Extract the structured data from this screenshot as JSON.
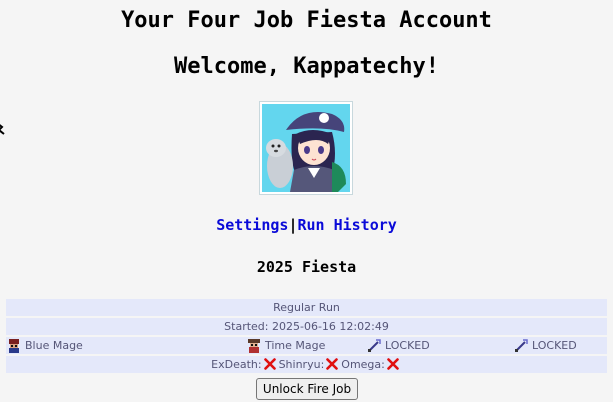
{
  "header": {
    "title": "Your Four Job Fiesta Account",
    "welcome": "Welcome, Kappatechy!"
  },
  "avatar": {
    "icon": "anime-girl-with-seal-avatar"
  },
  "nav": {
    "settings_label": "Settings",
    "separator": "|",
    "run_history_label": "Run History"
  },
  "fiesta": {
    "year_label": "2025 Fiesta"
  },
  "run": {
    "type_label": "Regular Run",
    "started_label": "Started: 2025-06-16 12:02:49",
    "jobs": [
      {
        "name": "Blue Mage",
        "icon": "blue-mage-sprite-icon"
      },
      {
        "name": "Time Mage",
        "icon": "time-mage-sprite-icon"
      },
      {
        "name": "LOCKED",
        "icon": "sword-icon"
      },
      {
        "name": "LOCKED",
        "icon": "sword-icon"
      }
    ],
    "bosses": [
      {
        "name": "ExDeath:",
        "status": "x-mark-icon"
      },
      {
        "name": "Shinryu:",
        "status": "x-mark-icon"
      },
      {
        "name": "Omega:",
        "status": "x-mark-icon"
      }
    ],
    "unlock_button_label": "Unlock Fire Job"
  },
  "colors": {
    "background": "#f5f5f5",
    "row_background": "#e4e8fa",
    "link": "#0a0ad8",
    "row_text": "#555577",
    "x_mark": "#e01010"
  }
}
